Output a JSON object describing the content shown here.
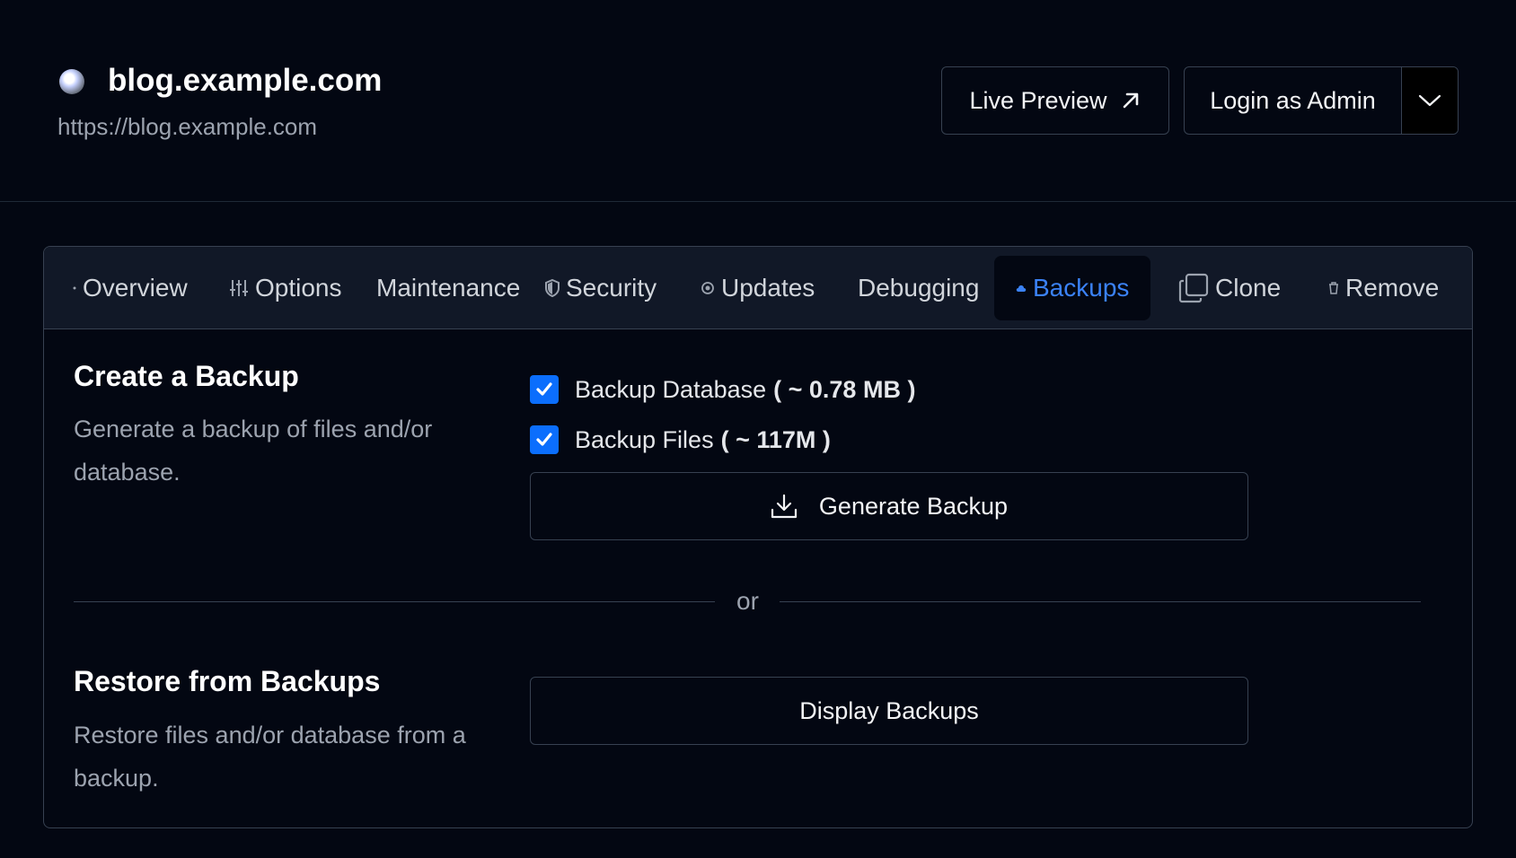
{
  "site": {
    "title": "blog.example.com",
    "url": "https://blog.example.com",
    "icon": "globe-icon"
  },
  "header_actions": {
    "live_preview_label": "Live Preview",
    "login_admin_label": "Login as Admin"
  },
  "tabs": [
    {
      "label": "Overview",
      "icon": "dot-icon",
      "active": false
    },
    {
      "label": "Options",
      "icon": "sliders-icon",
      "active": false
    },
    {
      "label": "Maintenance",
      "icon": "",
      "active": false
    },
    {
      "label": "Security",
      "icon": "shield-icon",
      "active": false
    },
    {
      "label": "Updates",
      "icon": "refresh-icon",
      "active": false
    },
    {
      "label": "Debugging",
      "icon": "",
      "active": false
    },
    {
      "label": "Backups",
      "icon": "cloud-icon",
      "active": true
    },
    {
      "label": "Clone",
      "icon": "copy-icon",
      "active": false
    },
    {
      "label": "Remove",
      "icon": "trash-icon",
      "active": false
    }
  ],
  "create_backup": {
    "title": "Create a Backup",
    "description": "Generate a backup of files and/or database.",
    "database": {
      "label": "Backup Database",
      "size": "( ~ 0.78 MB )",
      "checked": true
    },
    "files": {
      "label": "Backup Files",
      "size": "( ~ 117M )",
      "checked": true
    },
    "generate_label": "Generate Backup"
  },
  "divider_text": "or",
  "restore": {
    "title": "Restore from Backups",
    "description": "Restore files and/or database from a backup.",
    "display_label": "Display Backups"
  },
  "colors": {
    "background": "#030712",
    "tabbar": "#111827",
    "accent": "#3b82f6",
    "checkbox": "#0b6efd",
    "border": "#374151"
  }
}
